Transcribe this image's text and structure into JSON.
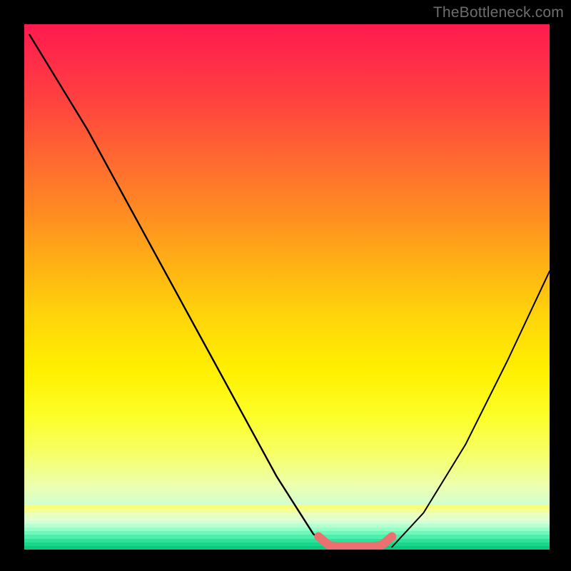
{
  "watermark": "TheBottleneck.com",
  "chart_data": {
    "type": "line",
    "title": "",
    "xlabel": "",
    "ylabel": "",
    "xlim": [
      0,
      100
    ],
    "ylim": [
      0,
      100
    ],
    "grid": false,
    "legend": false,
    "series": [
      {
        "name": "left-curve",
        "color": "#000000",
        "x": [
          1,
          12,
          24,
          36,
          48,
          55,
          58
        ],
        "y": [
          98,
          80,
          58,
          36,
          14,
          3,
          0.5
        ]
      },
      {
        "name": "right-curve",
        "color": "#000000",
        "x": [
          70,
          76,
          84,
          92,
          100
        ],
        "y": [
          0.5,
          7,
          20,
          36,
          53
        ]
      },
      {
        "name": "bottom-flat",
        "color": "#ec7070",
        "x": [
          56,
          58,
          60,
          62,
          64,
          66,
          68,
          70
        ],
        "y": [
          2.5,
          0.8,
          0.6,
          0.6,
          0.6,
          0.6,
          0.8,
          2.5
        ]
      }
    ],
    "gradient_stops": [
      {
        "pos": 0,
        "color": "#ff1a4d"
      },
      {
        "pos": 14,
        "color": "#ff4040"
      },
      {
        "pos": 36,
        "color": "#ff8c22"
      },
      {
        "pos": 56,
        "color": "#ffd60a"
      },
      {
        "pos": 75,
        "color": "#fcff2a"
      },
      {
        "pos": 92,
        "color": "#cfffd4"
      },
      {
        "pos": 100,
        "color": "#0cc97c"
      }
    ],
    "bottom_stripes": [
      "#f9ff7a",
      "#f3ff9a",
      "#ecffb8",
      "#e2ffcc",
      "#d2ffd8",
      "#b6ffd0",
      "#94ffc6",
      "#70f8ba",
      "#4cefac",
      "#2ee29a",
      "#18d68b",
      "#0cc97c"
    ]
  }
}
